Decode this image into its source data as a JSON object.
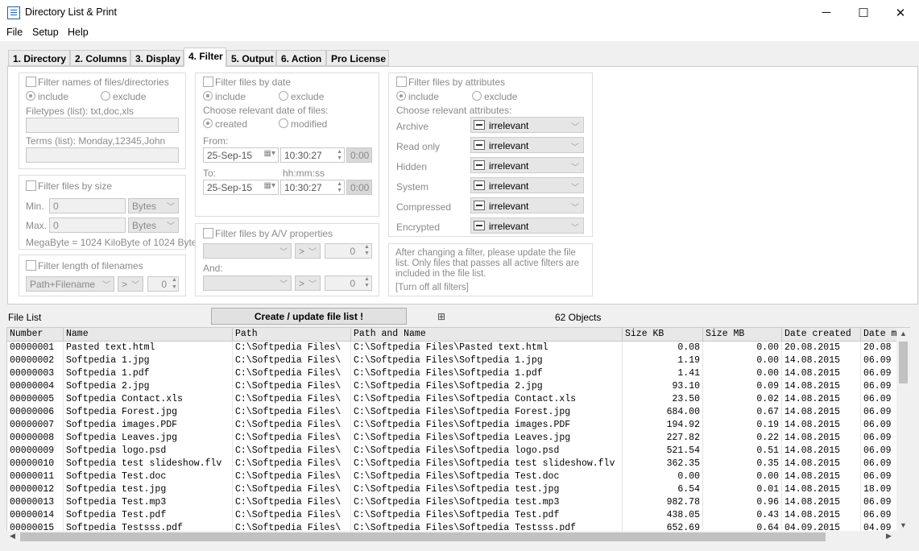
{
  "window": {
    "title": "Directory List & Print",
    "minimize": "─",
    "maximize": "☐",
    "close": "✕"
  },
  "menu": [
    "File",
    "Setup",
    "Help"
  ],
  "tabs": [
    "1. Directory",
    "2. Columns",
    "3. Display",
    "4. Filter",
    "5. Output",
    "6. Action",
    "Pro License"
  ],
  "names_filter": {
    "title": "Filter names of files/directories",
    "include": "include",
    "exclude": "exclude",
    "filetypes_label": "Filetypes (list): txt,doc,xls",
    "terms_label": "Terms (list): Monday,12345,John"
  },
  "size_filter": {
    "title": "Filter files by size",
    "min_label": "Min.",
    "max_label": "Max.",
    "min_value": "0",
    "max_value": "0",
    "min_unit": "Bytes",
    "max_unit": "Bytes",
    "note": "MegaByte = 1024 KiloByte of 1024 Byte"
  },
  "length_filter": {
    "title": "Filter length of filenames",
    "field": "Path+Filename",
    "op": ">",
    "value": "0"
  },
  "date_filter": {
    "title": "Filter files by date",
    "include": "include",
    "exclude": "exclude",
    "choose": "Choose relevant date of files:",
    "created": "created",
    "modified": "modified",
    "from_label": "From:",
    "to_label": "To:",
    "hms_label": "hh:mm:ss",
    "from_date": "25-Sep-15",
    "from_time": "10:30:27",
    "from_dur": "0:00",
    "to_date": "25-Sep-15",
    "to_time": "10:30:27",
    "to_dur": "0:00"
  },
  "av_filter": {
    "title": "Filter files by A/V properties",
    "op1": ">",
    "val1": "0",
    "and_label": "And:",
    "op2": ">",
    "val2": "0"
  },
  "attr_filter": {
    "title": "Filter files by attributes",
    "include": "include",
    "exclude": "exclude",
    "choose": "Choose relevant attributes:",
    "rows": [
      {
        "name": "Archive",
        "value": "irrelevant"
      },
      {
        "name": "Read only",
        "value": "irrelevant"
      },
      {
        "name": "Hidden",
        "value": "irrelevant"
      },
      {
        "name": "System",
        "value": "irrelevant"
      },
      {
        "name": "Compressed",
        "value": "irrelevant"
      },
      {
        "name": "Encrypted",
        "value": "irrelevant"
      }
    ]
  },
  "info": {
    "text": "After changing a filter, please update the file list. Only files that passes all active filters are included in the file list.",
    "link": "[Turn off all filters]"
  },
  "filelist": {
    "label": "File List",
    "button": "Create / update file list !",
    "count": "62 Objects"
  },
  "table": {
    "columns": [
      "Number",
      "Name",
      "Path",
      "Path and Name",
      "Size KB",
      "Size MB",
      "Date created",
      "Date m"
    ],
    "rows": [
      [
        "00000001",
        "Pasted text.html",
        "C:\\Softpedia Files\\",
        "C:\\Softpedia Files\\Pasted text.html",
        "0.08",
        "0.00",
        "20.08.2015",
        "20.08"
      ],
      [
        "00000002",
        "Softpedia 1.jpg",
        "C:\\Softpedia Files\\",
        "C:\\Softpedia Files\\Softpedia 1.jpg",
        "1.19",
        "0.00",
        "14.08.2015",
        "06.09"
      ],
      [
        "00000003",
        "Softpedia 1.pdf",
        "C:\\Softpedia Files\\",
        "C:\\Softpedia Files\\Softpedia 1.pdf",
        "1.41",
        "0.00",
        "14.08.2015",
        "06.09"
      ],
      [
        "00000004",
        "Softpedia 2.jpg",
        "C:\\Softpedia Files\\",
        "C:\\Softpedia Files\\Softpedia 2.jpg",
        "93.10",
        "0.09",
        "14.08.2015",
        "06.09"
      ],
      [
        "00000005",
        "Softpedia Contact.xls",
        "C:\\Softpedia Files\\",
        "C:\\Softpedia Files\\Softpedia Contact.xls",
        "23.50",
        "0.02",
        "14.08.2015",
        "06.09"
      ],
      [
        "00000006",
        "Softpedia Forest.jpg",
        "C:\\Softpedia Files\\",
        "C:\\Softpedia Files\\Softpedia Forest.jpg",
        "684.00",
        "0.67",
        "14.08.2015",
        "06.09"
      ],
      [
        "00000007",
        "Softpedia images.PDF",
        "C:\\Softpedia Files\\",
        "C:\\Softpedia Files\\Softpedia images.PDF",
        "194.92",
        "0.19",
        "14.08.2015",
        "06.09"
      ],
      [
        "00000008",
        "Softpedia Leaves.jpg",
        "C:\\Softpedia Files\\",
        "C:\\Softpedia Files\\Softpedia Leaves.jpg",
        "227.82",
        "0.22",
        "14.08.2015",
        "06.09"
      ],
      [
        "00000009",
        "Softpedia logo.psd",
        "C:\\Softpedia Files\\",
        "C:\\Softpedia Files\\Softpedia logo.psd",
        "521.54",
        "0.51",
        "14.08.2015",
        "06.09"
      ],
      [
        "00000010",
        "Softpedia test slideshow.flv",
        "C:\\Softpedia Files\\",
        "C:\\Softpedia Files\\Softpedia test slideshow.flv",
        "362.35",
        "0.35",
        "14.08.2015",
        "06.09"
      ],
      [
        "00000011",
        "Softpedia Test.doc",
        "C:\\Softpedia Files\\",
        "C:\\Softpedia Files\\Softpedia Test.doc",
        "0.00",
        "0.00",
        "14.08.2015",
        "06.09"
      ],
      [
        "00000012",
        "Softpedia test.jpg",
        "C:\\Softpedia Files\\",
        "C:\\Softpedia Files\\Softpedia test.jpg",
        "6.54",
        "0.01",
        "14.08.2015",
        "18.09"
      ],
      [
        "00000013",
        "Softpedia Test.mp3",
        "C:\\Softpedia Files\\",
        "C:\\Softpedia Files\\Softpedia test.mp3",
        "982.78",
        "0.96",
        "14.08.2015",
        "06.09"
      ],
      [
        "00000014",
        "Softpedia Test.pdf",
        "C:\\Softpedia Files\\",
        "C:\\Softpedia Files\\Softpedia Test.pdf",
        "438.05",
        "0.43",
        "14.08.2015",
        "06.09"
      ],
      [
        "00000015",
        "Softpedia Testsss.pdf",
        "C:\\Softpedia Files\\",
        "C:\\Softpedia Files\\Softpedia Testsss.pdf",
        "652.69",
        "0.64",
        "04.09.2015",
        "04.09"
      ]
    ]
  }
}
